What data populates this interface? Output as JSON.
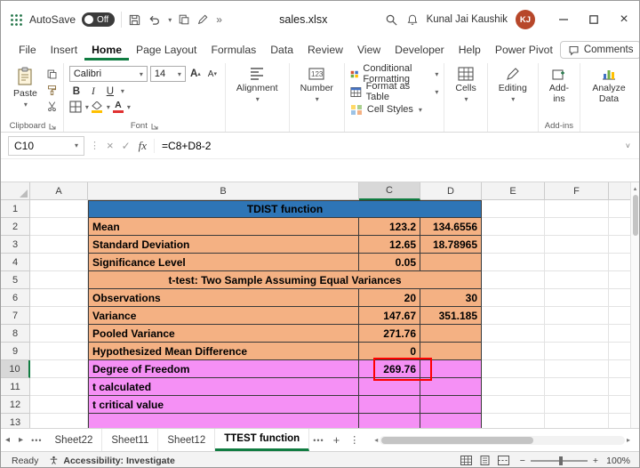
{
  "titlebar": {
    "autosave_label": "AutoSave",
    "autosave_state": "Off",
    "filename": "sales.xlsx",
    "user_name": "Kunal Jai Kaushik",
    "user_initials": "KJ"
  },
  "icons": {
    "dropdown": "▾",
    "overflow": "»",
    "dots": "⋮",
    "more": "•••",
    "prev": "◂",
    "next": "▸",
    "up": "▴",
    "plus": "+",
    "close": "×",
    "check": "✓",
    "cancel": "×",
    "minus": "−",
    "expand": "˅"
  },
  "tabs": {
    "items": [
      "File",
      "Insert",
      "Home",
      "Page Layout",
      "Formulas",
      "Data",
      "Review",
      "View",
      "Developer",
      "Help",
      "Power Pivot"
    ],
    "active": "Home",
    "comments": "Comments"
  },
  "ribbon": {
    "paste": "Paste",
    "clipboard_group": "Clipboard",
    "font_name": "Calibri",
    "font_size": "14",
    "bold": "B",
    "italic": "I",
    "underline": "U",
    "font_color_letter": "A",
    "grow_font": "A",
    "shrink_font": "A",
    "font_group": "Font",
    "alignment": "Alignment",
    "number": "Number",
    "conditional_formatting": "Conditional Formatting",
    "format_as_table": "Format as Table",
    "cell_styles": "Cell Styles",
    "cells": "Cells",
    "editing": "Editing",
    "addins": "Add-ins",
    "addins_group": "Add-ins",
    "analyze": "Analyze Data"
  },
  "formula_bar": {
    "name_box": "C10",
    "fx": "fx",
    "formula": "=C8+D8-2"
  },
  "grid": {
    "columns": [
      "A",
      "B",
      "C",
      "D",
      "E",
      "F"
    ],
    "selected_column": "C",
    "selected_row": "10",
    "active_cell": "C10",
    "colors": {
      "title_bg": "#2E75B6",
      "peach": "#F4B183",
      "pink": "#F590F5",
      "annotation": "#FF0000",
      "accent_green": "#107C41"
    },
    "rows": [
      {
        "n": "1",
        "merge": true,
        "zone": "blue",
        "text": "TDIST function"
      },
      {
        "n": "2",
        "zone": "peach",
        "b": "Mean",
        "c": "123.2",
        "d": "134.6556"
      },
      {
        "n": "3",
        "zone": "peach",
        "b": "Standard Deviation",
        "c": "12.65",
        "d": "18.78965"
      },
      {
        "n": "4",
        "zone": "peach",
        "b": "Significance Level",
        "c": "0.05",
        "d": ""
      },
      {
        "n": "5",
        "merge": true,
        "zone": "peach",
        "text": "t-test: Two Sample Assuming Equal Variances"
      },
      {
        "n": "6",
        "zone": "peach",
        "b": "Observations",
        "c": "20",
        "d": "30"
      },
      {
        "n": "7",
        "zone": "peach",
        "b": "Variance",
        "c": "147.67",
        "d": "351.185"
      },
      {
        "n": "8",
        "zone": "peach",
        "b": "Pooled Variance",
        "c": "271.76",
        "d": ""
      },
      {
        "n": "9",
        "zone": "peach",
        "b": "Hypothesized Mean Difference",
        "c": "0",
        "d": ""
      },
      {
        "n": "10",
        "zone": "pink",
        "b": "Degree of Freedom",
        "c": "269.76",
        "d": "",
        "selected": true
      },
      {
        "n": "11",
        "zone": "pink",
        "b": "t calculated",
        "c": "",
        "d": ""
      },
      {
        "n": "12",
        "zone": "pink",
        "b": "t critical value",
        "c": "",
        "d": ""
      },
      {
        "n": "13",
        "zone": "pink",
        "b": "",
        "c": "",
        "d": ""
      }
    ]
  },
  "sheet_bar": {
    "tabs": [
      "Sheet22",
      "Sheet11",
      "Sheet12",
      "TTEST function"
    ],
    "active": "TTEST function"
  },
  "status_bar": {
    "ready": "Ready",
    "accessibility": "Accessibility: Investigate",
    "zoom": "100%"
  }
}
